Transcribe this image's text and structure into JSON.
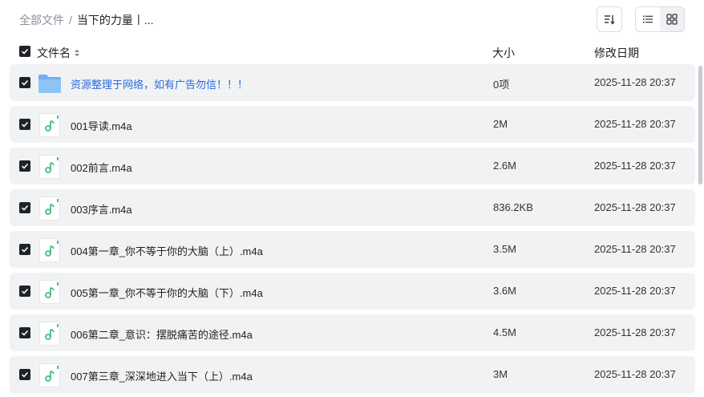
{
  "breadcrumb": {
    "root": "全部文件",
    "separator": "/",
    "current": "当下的力量丨..."
  },
  "toolbar": {
    "sort_icon": "sort-icon",
    "list_view_icon": "list-view-icon",
    "grid_view_icon": "grid-view-icon",
    "active_view": "list"
  },
  "columns": {
    "name": "文件名",
    "size": "大小",
    "date": "修改日期"
  },
  "rows": [
    {
      "name": "资源整理于网络，如有广告勿信！！！",
      "size": "0项",
      "date": "2025-11-28 20:37",
      "type": "folder"
    },
    {
      "name": "001导读.m4a",
      "size": "2M",
      "date": "2025-11-28 20:37",
      "type": "audio"
    },
    {
      "name": "002前言.m4a",
      "size": "2.6M",
      "date": "2025-11-28 20:37",
      "type": "audio"
    },
    {
      "name": "003序言.m4a",
      "size": "836.2KB",
      "date": "2025-11-28 20:37",
      "type": "audio"
    },
    {
      "name": "004第一章_你不等于你的大脑（上）.m4a",
      "size": "3.5M",
      "date": "2025-11-28 20:37",
      "type": "audio"
    },
    {
      "name": "005第一章_你不等于你的大脑（下）.m4a",
      "size": "3.6M",
      "date": "2025-11-28 20:37",
      "type": "audio"
    },
    {
      "name": "006第二章_意识：摆脱痛苦的途径.m4a",
      "size": "4.5M",
      "date": "2025-11-28 20:37",
      "type": "audio"
    },
    {
      "name": "007第三章_深深地进入当下（上）.m4a",
      "size": "3M",
      "date": "2025-11-28 20:37",
      "type": "audio"
    }
  ],
  "colors": {
    "folder_link": "#2a6ad8",
    "audio_accent": "#3fbf7f",
    "row_bg": "#f1f2f4",
    "checkbox": "#1f2329"
  }
}
